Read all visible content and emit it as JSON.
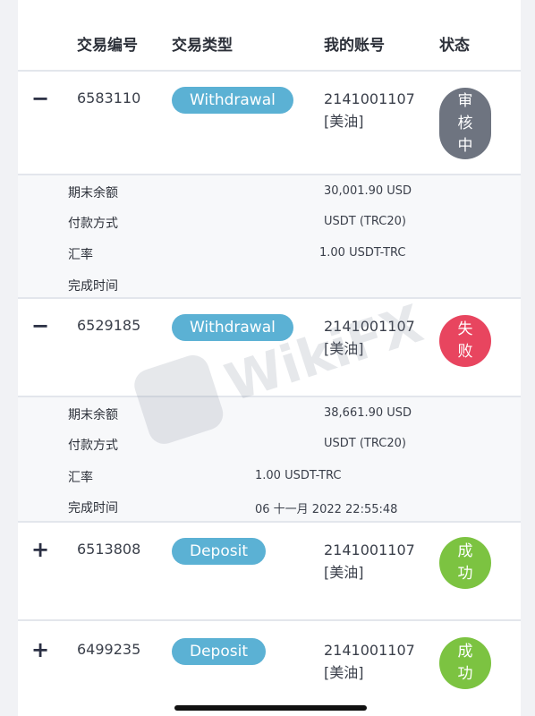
{
  "header": {
    "col_id": "交易编号",
    "col_type": "交易类型",
    "col_account": "我的账号",
    "col_status": "状态"
  },
  "transactions": [
    {
      "toggle": "−",
      "id": "6583110",
      "type": "Withdrawal",
      "account_number": "2141001107",
      "account_label": "[美油]",
      "status_chars": [
        "审",
        "核",
        "中"
      ],
      "status_color": "#6e7480",
      "details": {
        "balance_label": "期末余额",
        "balance_value": "30,001.90 USD",
        "method_label": "付款方式",
        "method_value": "USDT (TRC20)",
        "rate_label": "汇率",
        "rate_value": "1.00 USDT-TRC",
        "time_label": "完成时间",
        "time_value": ""
      }
    },
    {
      "toggle": "−",
      "id": "6529185",
      "type": "Withdrawal",
      "account_number": "2141001107",
      "account_label": "[美油]",
      "status_chars": [
        "失",
        "败"
      ],
      "status_color": "#e8455f",
      "details": {
        "balance_label": "期末余额",
        "balance_value": "38,661.90 USD",
        "method_label": "付款方式",
        "method_value": "USDT (TRC20)",
        "rate_label": "汇率",
        "rate_value": "1.00 USDT-TRC",
        "time_label": "完成时间",
        "time_value": "06 十一月 2022 22:55:48"
      }
    },
    {
      "toggle": "+",
      "id": "6513808",
      "type": "Deposit",
      "account_number": "2141001107",
      "account_label": "[美油]",
      "status_chars": [
        "成",
        "功"
      ],
      "status_color": "#7cc341"
    },
    {
      "toggle": "+",
      "id": "6499235",
      "type": "Deposit",
      "account_number": "2141001107",
      "account_label": "[美油]",
      "status_chars": [
        "成",
        "功"
      ],
      "status_color": "#7cc341"
    }
  ],
  "watermark": {
    "text": "WikiFX"
  }
}
